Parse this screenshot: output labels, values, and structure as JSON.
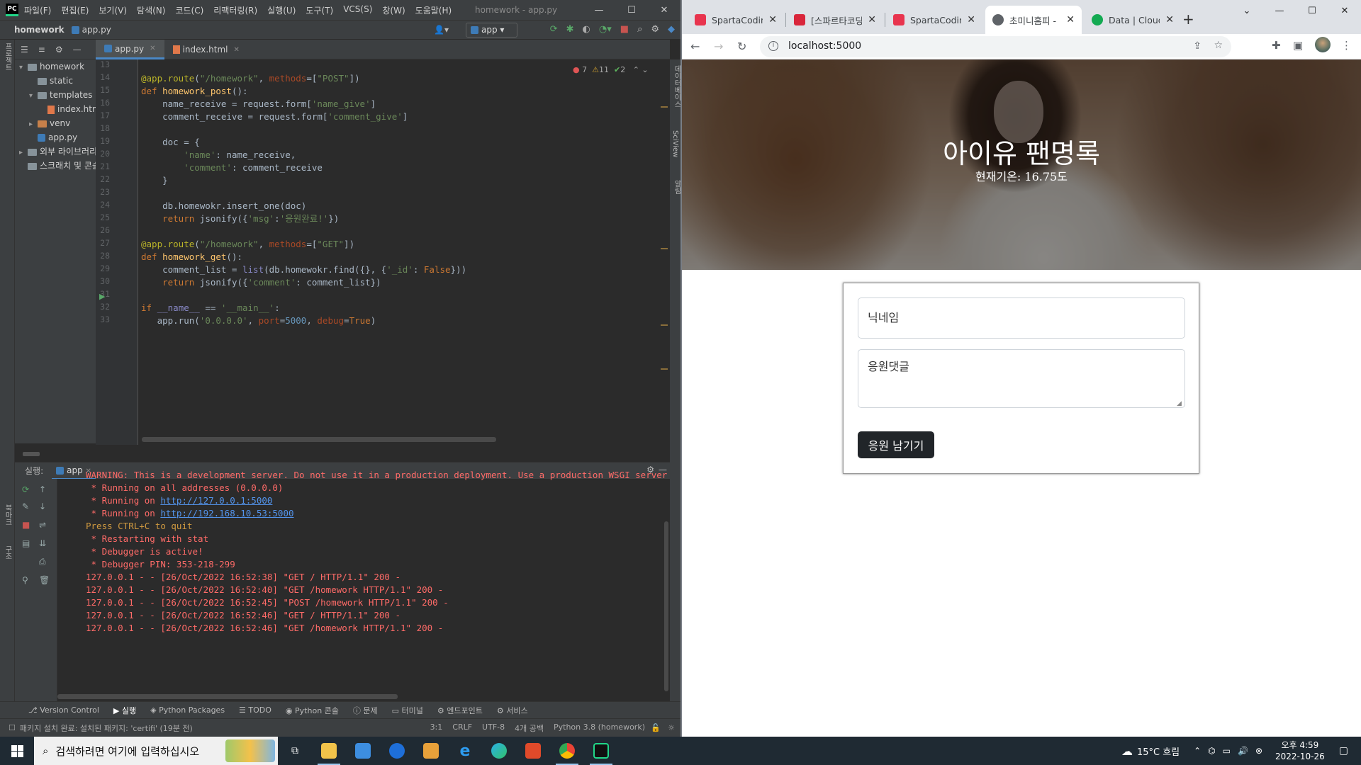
{
  "ide": {
    "menu": [
      "파일(F)",
      "편집(E)",
      "보기(V)",
      "탐색(N)",
      "코드(C)",
      "리팩터링(R)",
      "실행(U)",
      "도구(T)",
      "VCS(S)",
      "창(W)",
      "도움말(H)"
    ],
    "window_title": "homework - app.py",
    "breadcrumb_project": "homework",
    "breadcrumb_file": "app.py",
    "run_config": "app",
    "left_vtabs": [
      "프로젝트",
      "북마크",
      "구조"
    ],
    "right_vtabs": [
      "데이터베이스",
      "SciView",
      "알림"
    ],
    "tree": [
      {
        "label": "homework",
        "type": "folder",
        "indent": 0
      },
      {
        "label": "static",
        "type": "folder",
        "indent": 1
      },
      {
        "label": "templates",
        "type": "folder",
        "indent": 1
      },
      {
        "label": "index.html",
        "type": "html",
        "indent": 2
      },
      {
        "label": "venv",
        "type": "folder-orange",
        "indent": 1
      },
      {
        "label": "app.py",
        "type": "py",
        "indent": 1
      },
      {
        "label": "외부 라이브러리",
        "type": "lib",
        "indent": 0
      },
      {
        "label": "스크래치 및 콘솔",
        "type": "scratch",
        "indent": 0
      }
    ],
    "tabs": [
      {
        "label": "app.py",
        "active": true
      },
      {
        "label": "index.html",
        "active": false
      }
    ],
    "inspections": {
      "errors": "7",
      "warnings": "11",
      "ok": "2"
    },
    "line_numbers": [
      "13",
      "14",
      "15",
      "16",
      "17",
      "18",
      "19",
      "20",
      "21",
      "22",
      "23",
      "24",
      "25",
      "26",
      "27",
      "28",
      "29",
      "30",
      "31",
      "32",
      "33"
    ],
    "code_lines": [
      "",
      "@app.route(\"/homework\", methods=[\"POST\"])",
      "def homework_post():",
      "    name_receive = request.form['name_give']",
      "    comment_receive = request.form['comment_give']",
      "",
      "    doc = {",
      "        'name': name_receive,",
      "        'comment': comment_receive",
      "    }",
      "",
      "    db.homewokr.insert_one(doc)",
      "    return jsonify({'msg':'응원완료!'})",
      "",
      "@app.route(\"/homework\", methods=[\"GET\"])",
      "def homework_get():",
      "    comment_list = list(db.homewokr.find({}, {'_id': False}))",
      "    return jsonify({'comment': comment_list})",
      "",
      "if __name__ == '__main__':",
      "   app.run('0.0.0.0', port=5000, debug=True)"
    ],
    "run_label": "실행:",
    "run_tab": "app",
    "console": [
      {
        "text": "WARNING: This is a development server. Do not use it in a production deployment. Use a production WSGI server instead.",
        "cls": "red"
      },
      {
        "text": " * Running on all addresses (0.0.0.0)",
        "cls": "red"
      },
      {
        "text": " * Running on ",
        "cls": "red",
        "link": "http://127.0.0.1:5000"
      },
      {
        "text": " * Running on ",
        "cls": "red",
        "link": "http://192.168.10.53:5000"
      },
      {
        "text": "Press CTRL+C to quit",
        "cls": "orange"
      },
      {
        "text": " * Restarting with stat",
        "cls": "red"
      },
      {
        "text": " * Debugger is active!",
        "cls": "red"
      },
      {
        "text": " * Debugger PIN: 353-218-299",
        "cls": "red"
      },
      {
        "text": "127.0.0.1 - - [26/Oct/2022 16:52:38] \"GET / HTTP/1.1\" 200 -",
        "cls": "red"
      },
      {
        "text": "127.0.0.1 - - [26/Oct/2022 16:52:40] \"GET /homework HTTP/1.1\" 200 -",
        "cls": "red"
      },
      {
        "text": "127.0.0.1 - - [26/Oct/2022 16:52:45] \"POST /homework HTTP/1.1\" 200 -",
        "cls": "red"
      },
      {
        "text": "127.0.0.1 - - [26/Oct/2022 16:52:46] \"GET / HTTP/1.1\" 200 -",
        "cls": "red"
      },
      {
        "text": "127.0.0.1 - - [26/Oct/2022 16:52:46] \"GET /homework HTTP/1.1\" 200 -",
        "cls": "red"
      }
    ],
    "bottom_tabs": [
      "Version Control",
      "실행",
      "Python Packages",
      "TODO",
      "Python 콘솔",
      "문제",
      "터미널",
      "엔드포인트",
      "서비스"
    ],
    "status_left": "패키지 설치 완료: 설치된 패키지: 'certifi' (19분 전)",
    "status_right": [
      "3:1",
      "CRLF",
      "UTF-8",
      "4개 공백",
      "Python 3.8 (homework)"
    ]
  },
  "browser": {
    "tabs": [
      {
        "label": "SpartaCoding",
        "color": "#e8344e",
        "active": false
      },
      {
        "label": "[스파르타코딩",
        "color": "#d9263b",
        "active": false
      },
      {
        "label": "SpartaCoding",
        "color": "#e8344e",
        "active": false
      },
      {
        "label": "초미니홈피 -",
        "color": "#5f6368",
        "active": true
      },
      {
        "label": "Data | Cloud",
        "color": "#13aa52",
        "active": false
      }
    ],
    "url": "localhost:5000",
    "page": {
      "title": "아이유 팬명록",
      "temperature": "현재기온: 16.75도",
      "nickname_placeholder": "닉네임",
      "comment_placeholder": "응원댓글",
      "submit_label": "응원 남기기"
    }
  },
  "taskbar": {
    "search_placeholder": "검색하려면 여기에 입력하십시오",
    "weather": "15°C  흐림",
    "time": "오후 4:59",
    "date": "2022-10-26"
  },
  "colors": {
    "ide_bg": "#2b2b2b",
    "keyword": "#cc7832",
    "string": "#6a8759",
    "console_red": "#ff6b68",
    "button_dark": "#212529"
  }
}
